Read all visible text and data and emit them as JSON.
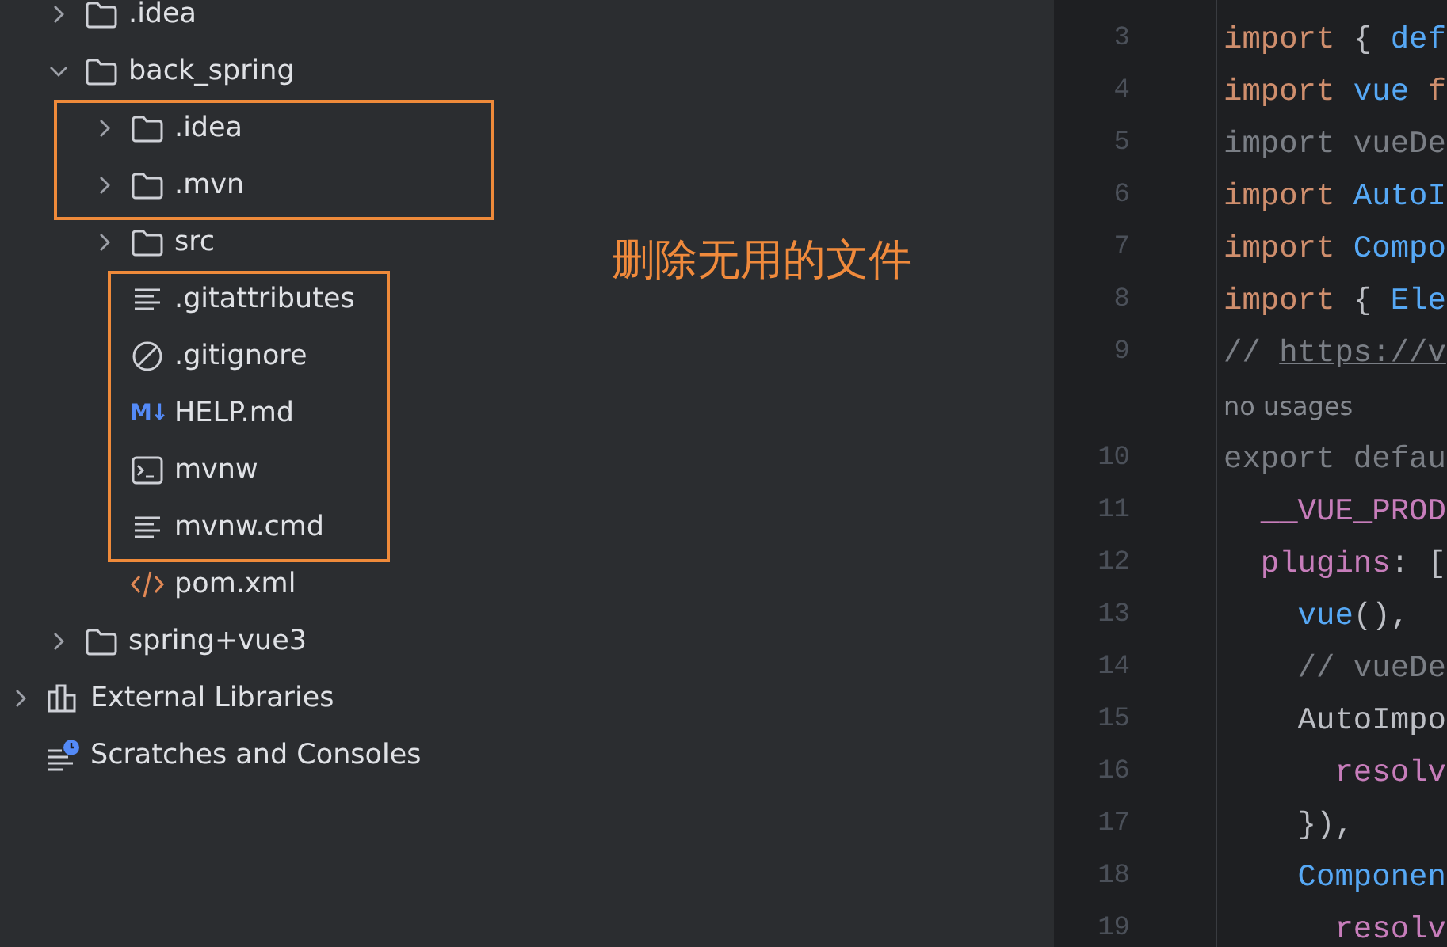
{
  "project_tree": [
    {
      "label": ".idea",
      "kind": "folder",
      "expanded": false
    },
    {
      "label": "back_spring",
      "kind": "folder",
      "expanded": true,
      "children": [
        {
          "label": ".idea",
          "kind": "folder",
          "expanded": false,
          "boxed": true
        },
        {
          "label": ".mvn",
          "kind": "folder",
          "expanded": false,
          "boxed": true
        },
        {
          "label": "src",
          "kind": "folder",
          "expanded": false
        },
        {
          "label": ".gitattributes",
          "kind": "text",
          "boxed": true
        },
        {
          "label": ".gitignore",
          "kind": "ignore",
          "boxed": true
        },
        {
          "label": "HELP.md",
          "kind": "markdown",
          "icon_glyph": "M↓",
          "boxed": true
        },
        {
          "label": "mvnw",
          "kind": "terminal",
          "boxed": true
        },
        {
          "label": "mvnw.cmd",
          "kind": "text",
          "boxed": true
        },
        {
          "label": "pom.xml",
          "kind": "xml"
        }
      ]
    },
    {
      "label": "spring+vue3",
      "kind": "folder",
      "expanded": false
    }
  ],
  "root_nodes": [
    {
      "label": "External Libraries",
      "kind": "library",
      "expanded": false
    },
    {
      "label": "Scratches and Consoles",
      "kind": "scratches"
    }
  ],
  "annotation": {
    "label": "删除无用的文件"
  },
  "editor": {
    "lines": [
      {
        "number": "3",
        "tokens": [
          {
            "text": "import",
            "kind": "keyword"
          },
          {
            "text": " { ",
            "kind": "plain"
          },
          {
            "text": "def",
            "kind": "ident"
          }
        ]
      },
      {
        "number": "4",
        "tokens": [
          {
            "text": "import",
            "kind": "keyword"
          },
          {
            "text": " vue",
            "kind": "ident"
          },
          {
            "text": " f",
            "kind": "keyword"
          }
        ]
      },
      {
        "number": "5",
        "tokens": [
          {
            "text": "import vueDe",
            "kind": "dim"
          }
        ]
      },
      {
        "number": "6",
        "tokens": [
          {
            "text": "import",
            "kind": "keyword"
          },
          {
            "text": " AutoI",
            "kind": "ident"
          }
        ]
      },
      {
        "number": "7",
        "tokens": [
          {
            "text": "import",
            "kind": "keyword"
          },
          {
            "text": " Compo",
            "kind": "ident"
          }
        ]
      },
      {
        "number": "8",
        "tokens": [
          {
            "text": "import",
            "kind": "keyword"
          },
          {
            "text": " { ",
            "kind": "plain"
          },
          {
            "text": "Ele",
            "kind": "ident"
          }
        ]
      },
      {
        "number": "9",
        "tokens": [
          {
            "text": "// ",
            "kind": "comment"
          },
          {
            "text": "https://v",
            "kind": "link"
          }
        ]
      },
      {
        "hint": "no usages"
      },
      {
        "number": "10",
        "tokens": [
          {
            "text": "export defau",
            "kind": "dim"
          }
        ]
      },
      {
        "number": "11",
        "tokens": [
          {
            "text": "  __VUE_PROD",
            "kind": "field"
          }
        ]
      },
      {
        "number": "12",
        "tokens": [
          {
            "text": "  plugins",
            "kind": "field"
          },
          {
            "text": ": [",
            "kind": "plain"
          }
        ]
      },
      {
        "number": "13",
        "tokens": [
          {
            "text": "    vue",
            "kind": "ident"
          },
          {
            "text": "(),",
            "kind": "plain"
          }
        ]
      },
      {
        "number": "14",
        "tokens": [
          {
            "text": "    // vueDe",
            "kind": "comment"
          }
        ]
      },
      {
        "number": "15",
        "tokens": [
          {
            "text": "    AutoImpo",
            "kind": "plain"
          }
        ]
      },
      {
        "number": "16",
        "tokens": [
          {
            "text": "      resolv",
            "kind": "field"
          }
        ]
      },
      {
        "number": "17",
        "tokens": [
          {
            "text": "    }),",
            "kind": "plain"
          }
        ]
      },
      {
        "number": "18",
        "tokens": [
          {
            "text": "    Componen",
            "kind": "ident"
          }
        ]
      },
      {
        "number": "19",
        "tokens": [
          {
            "text": "      resolv",
            "kind": "field"
          }
        ]
      }
    ]
  }
}
